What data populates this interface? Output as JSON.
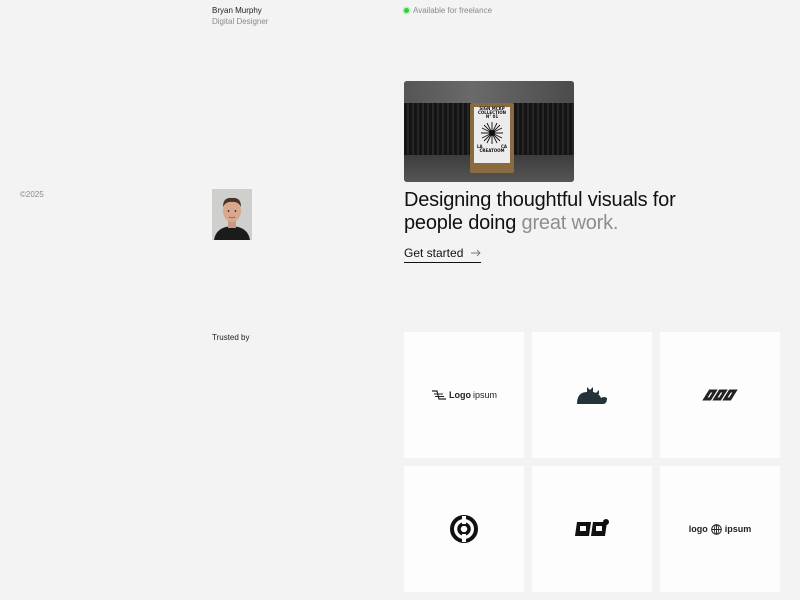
{
  "header": {
    "name": "Bryan Murphy",
    "role": "Digital Designer",
    "status": "Available for freelance",
    "status_color": "#2bd43b"
  },
  "footer": {
    "copyright": "©2025"
  },
  "hero": {
    "image_poster_lines": [
      "SIGN MCKP",
      "COLLECTION",
      "N°   01",
      "LA",
      "CA",
      "CREATOOM"
    ],
    "headline_main": "Designing thoughtful visuals for people doing ",
    "headline_muted": "great work.",
    "cta_label": "Get started"
  },
  "trusted": {
    "label": "Trusted by",
    "logos": [
      {
        "name": "logoipsum-wordmark",
        "text_bold": "Logo",
        "text_light": "ipsum"
      },
      {
        "name": "cat-logo"
      },
      {
        "name": "infinity-links-logo"
      },
      {
        "name": "swirl-logo"
      },
      {
        "name": "block-letters-logo"
      },
      {
        "name": "logo-globe-ipsum",
        "text_left": "logo",
        "text_right": "ipsum"
      }
    ]
  }
}
